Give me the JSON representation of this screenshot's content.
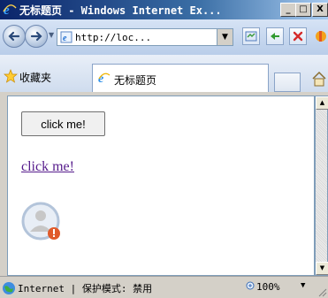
{
  "window": {
    "title": "无标题页 - Windows Internet Ex...",
    "minimize_label": "_",
    "maximize_label": "□",
    "close_label": "X"
  },
  "nav": {
    "address_value": "http://loc...",
    "address_dropdown": "▼"
  },
  "favorites": {
    "label": "收藏夹",
    "tab_title": "无标题页"
  },
  "page": {
    "button_label": "click me!",
    "link_text": "click me!"
  },
  "status": {
    "text": "Internet | 保护模式: 禁用",
    "zoom": "100%",
    "zoom_dropdown": "▼"
  },
  "icons": {
    "title": "ie-logo-icon",
    "back": "back-arrow-icon",
    "forward": "forward-arrow-icon",
    "compat": "compatibility-view-icon",
    "refresh": "refresh-icon",
    "stop": "stop-icon",
    "favorites": "star-icon",
    "home": "home-icon",
    "status": "globe-icon",
    "broken_image": "user-avatar-error-icon"
  }
}
